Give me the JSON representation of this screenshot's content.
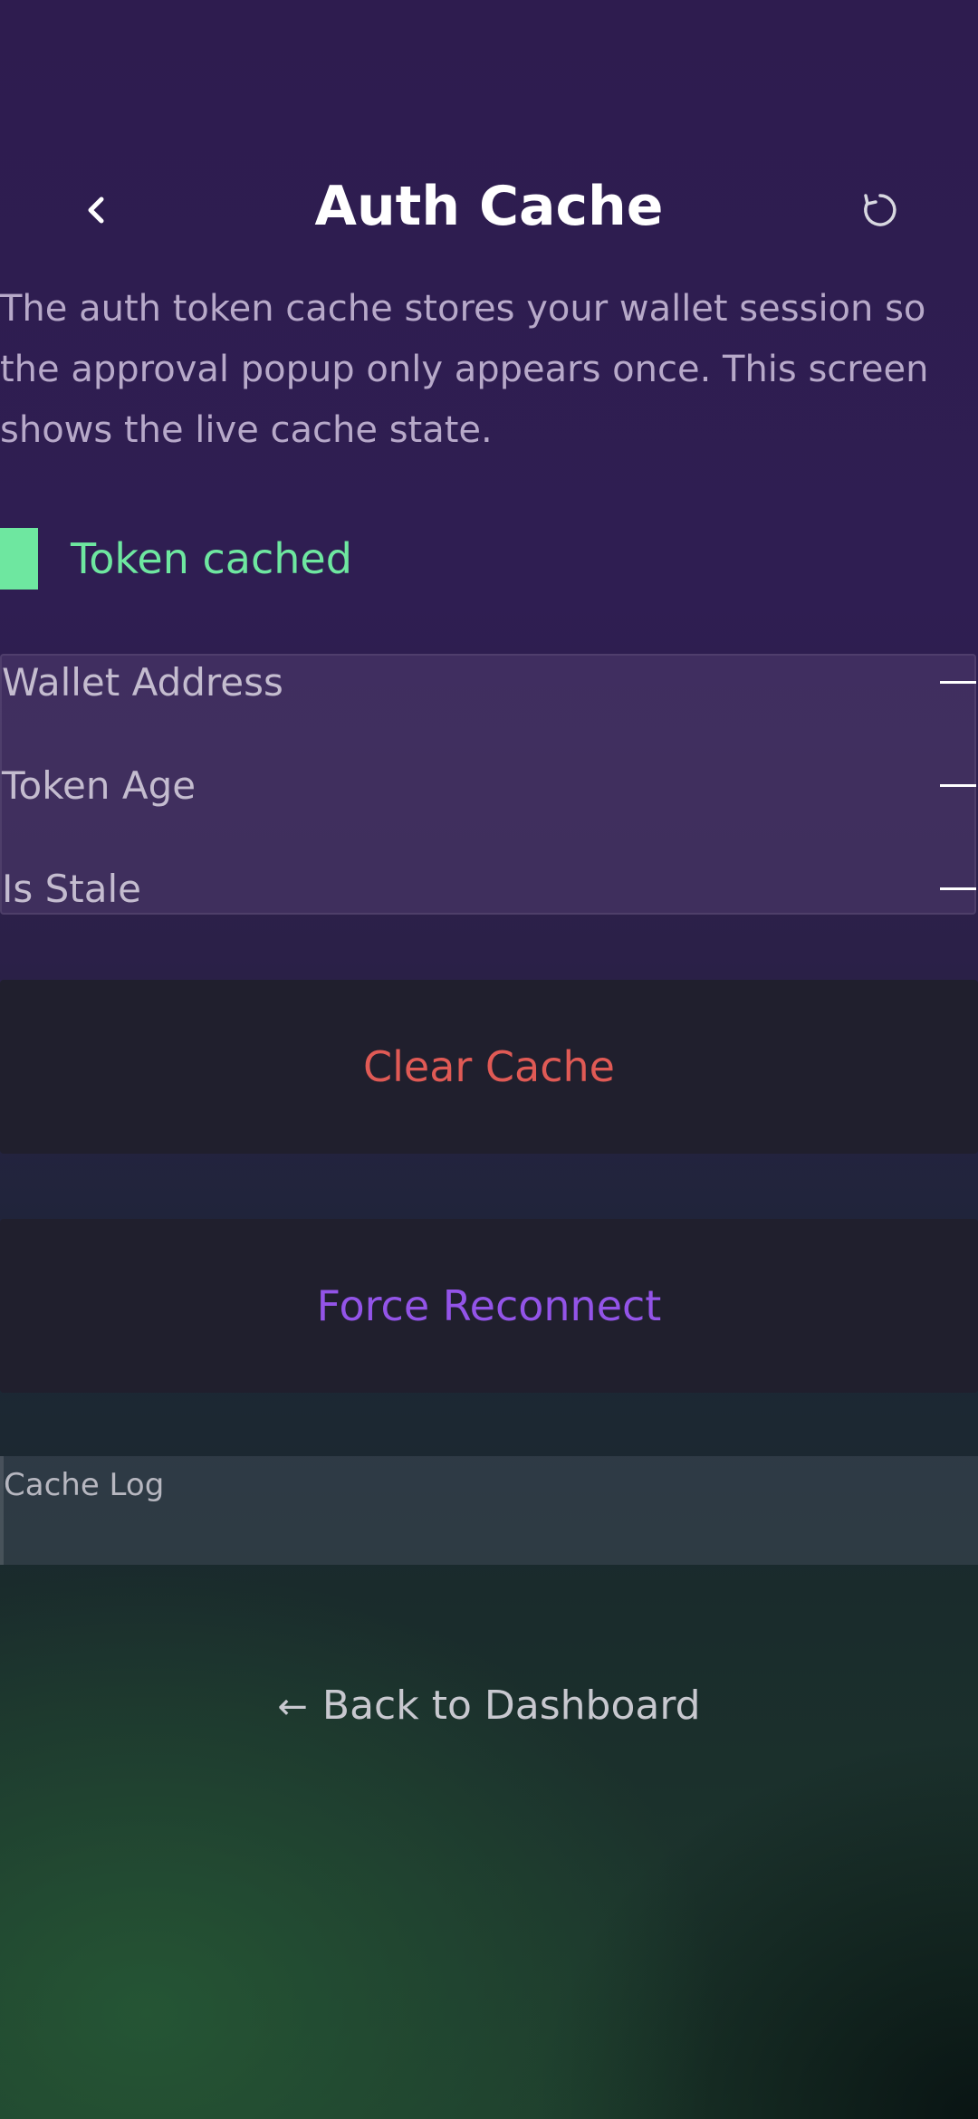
{
  "header": {
    "title": "Auth Cache",
    "back_icon": "chevron-left-icon",
    "refresh_icon": "refresh-icon"
  },
  "description": "The auth token cache stores your wallet session so the approval popup only appears once. This screen shows the live cache state.",
  "status": {
    "label": "Token cached",
    "color": "#6ee7a0"
  },
  "info": {
    "rows": [
      {
        "label": "Wallet Address",
        "value": "—"
      },
      {
        "label": "Token Age",
        "value": "—"
      },
      {
        "label": "Is Stale",
        "value": "—"
      }
    ]
  },
  "actions": {
    "clear_label": "Clear Cache",
    "clear_color": "#e05a55",
    "reconnect_label": "Force Reconnect",
    "reconnect_color": "#9354e8"
  },
  "log": {
    "label": "Cache Log"
  },
  "footer": {
    "back_arrow": "←",
    "back_label": "Back to Dashboard"
  }
}
